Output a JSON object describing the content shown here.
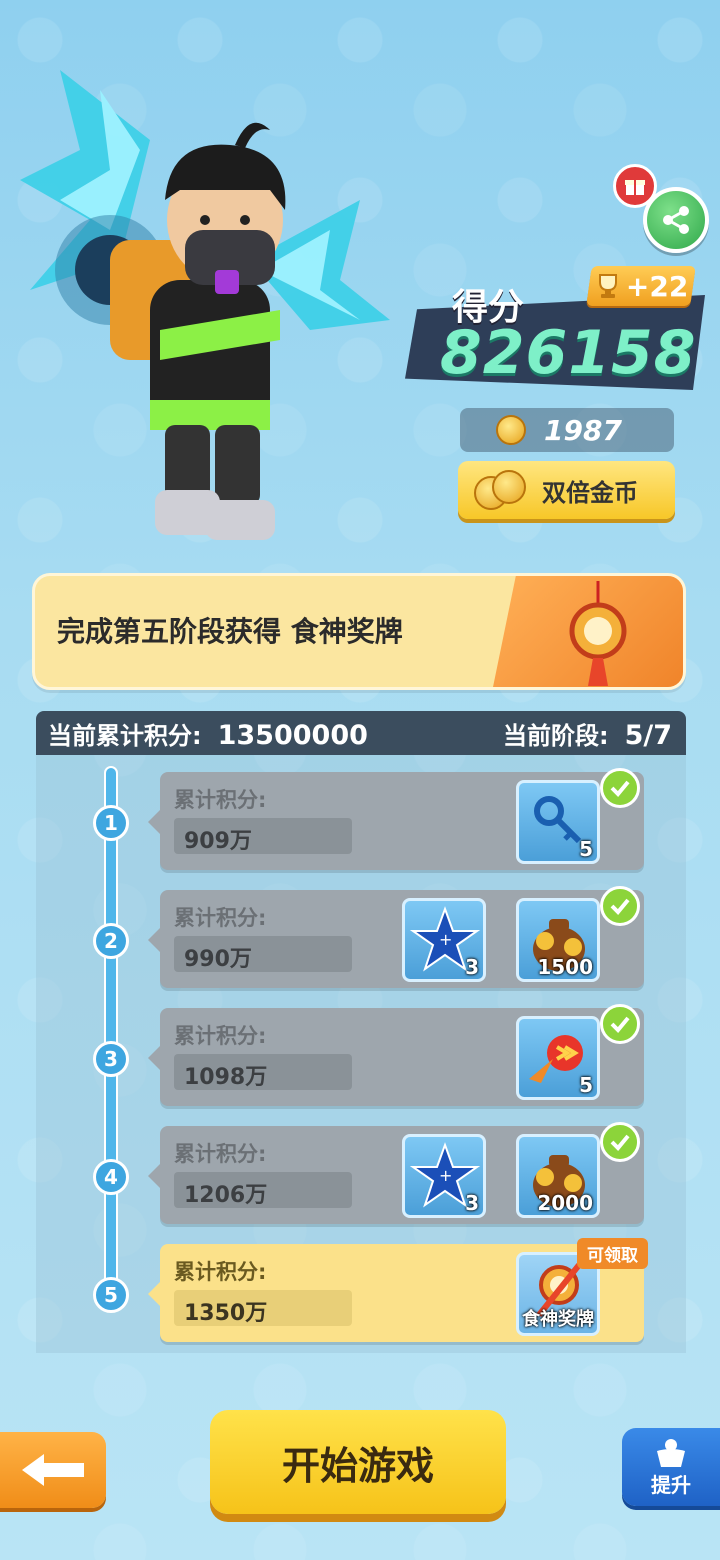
{
  "score": {
    "label": "得分",
    "value": "826158",
    "trophy_bonus": "+22"
  },
  "coins": {
    "value": "1987",
    "double_button_label": "双倍金币"
  },
  "stage_banner": {
    "text": "完成第五阶段获得 食神奖牌"
  },
  "progress": {
    "total_label": "当前累计积分:",
    "total_value": "13500000",
    "stage_label": "当前阶段:",
    "stage_value": "5/7"
  },
  "stages": [
    {
      "num": "1",
      "label": "累计积分:",
      "value": "909万",
      "rewards": [
        {
          "icon": "keys-icon",
          "count": "5"
        }
      ],
      "claimed": true
    },
    {
      "num": "2",
      "label": "累计积分:",
      "value": "990万",
      "rewards": [
        {
          "icon": "star-icon",
          "count": "3"
        },
        {
          "icon": "coin-bag-icon",
          "count": "1500"
        }
      ],
      "claimed": true
    },
    {
      "num": "3",
      "label": "累计积分:",
      "value": "1098万",
      "rewards": [
        {
          "icon": "fire-boost-icon",
          "count": "5"
        }
      ],
      "claimed": true
    },
    {
      "num": "4",
      "label": "累计积分:",
      "value": "1206万",
      "rewards": [
        {
          "icon": "star-icon",
          "count": "3"
        },
        {
          "icon": "coin-bag-icon",
          "count": "2000"
        }
      ],
      "claimed": true
    },
    {
      "num": "5",
      "label": "累计积分:",
      "value": "1350万",
      "rewards": [
        {
          "icon": "medal-icon",
          "name": "食神奖牌"
        }
      ],
      "claimed": false,
      "tag": "可领取"
    }
  ],
  "buttons": {
    "start": "开始游戏",
    "upgrade": "提升"
  },
  "colors": {
    "accent_green": "#7ef0c8",
    "button_yellow": "#f6c319",
    "button_blue": "#1f62c6",
    "button_orange": "#f08d18"
  }
}
